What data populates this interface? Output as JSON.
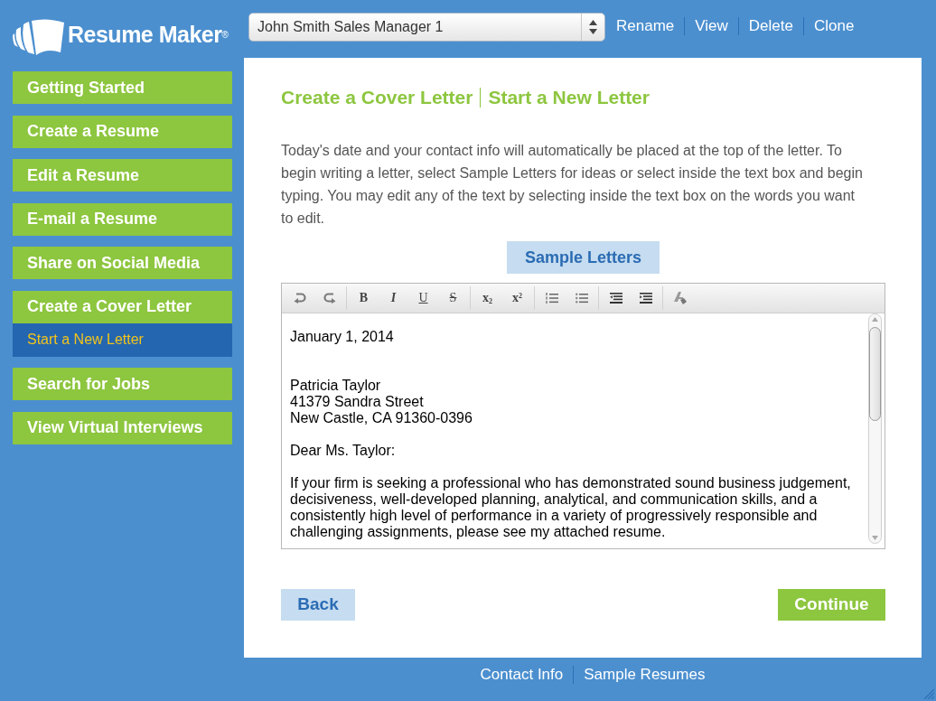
{
  "app": {
    "logo_text": "Resume Maker$^{®}$"
  },
  "resume_selector": {
    "value": "John Smith Sales Manager 1"
  },
  "resume_actions": [
    "Rename",
    "View",
    "Delete",
    "Clone"
  ],
  "sidebar": {
    "items": [
      {
        "label": "Getting Started",
        "selected": false
      },
      {
        "label": "Create a Resume",
        "selected": false
      },
      {
        "label": "Edit a Resume",
        "selected": false
      },
      {
        "label": "E-mail a Resume",
        "selected": false
      },
      {
        "label": "Share on Social Media",
        "selected": false
      },
      {
        "label": "Create a Cover Letter",
        "selected": false,
        "children": [
          {
            "label": "Start a New Letter",
            "selected": true
          }
        ]
      },
      {
        "label": "Search for Jobs",
        "selected": false
      },
      {
        "label": "View Virtual Interviews",
        "selected": false
      }
    ]
  },
  "page": {
    "title": "Create a Cover Letter",
    "subtitle": "Start a New Letter",
    "instructions": "Today's date and your contact info will automatically be placed at the top of the letter. To begin writing a letter, select Sample Letters for ideas or select inside the text box and begin typing. You may edit any of the text by selecting inside the text box on the words you want to edit.",
    "sample_button": "Sample Letters",
    "editor": {
      "toolbar": {
        "format_buttons": [
          {
            "kind": "bold",
            "label": "B"
          },
          {
            "kind": "italic",
            "label": "I"
          },
          {
            "kind": "underline",
            "label": "U"
          },
          {
            "kind": "strike",
            "label": "S"
          }
        ],
        "script_buttons": [
          {
            "kind": "subscript",
            "label": "x$_{2}$"
          },
          {
            "kind": "superscript",
            "label": "x$^{2}$"
          }
        ]
      },
      "letter": {
        "date": "January 1, 2014",
        "recipient": [
          "Patricia Taylor",
          "41379 Sandra Street",
          "New Castle, CA 91360-0396"
        ],
        "salutation": "Dear Ms. Taylor:",
        "body": "If your firm is seeking a professional who has demonstrated sound business judgement, decisiveness, well-developed planning, analytical, and communication skills, and a consistently high level of performance in a variety of progressively responsible and challenging assignments, please see my attached resume."
      }
    },
    "back_button": "Back",
    "continue_button": "Continue"
  },
  "footer_links": [
    "Contact Info",
    "Sample Resumes"
  ]
}
